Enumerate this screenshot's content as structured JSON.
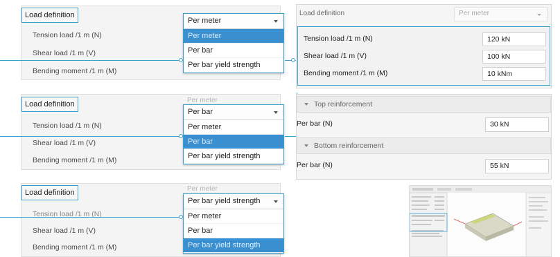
{
  "left_panels": [
    {
      "load_definition_label": "Load definition",
      "rows": [
        "Tension load /1 m (N)",
        "Shear load /1 m (V)",
        "Bending moment /1 m (M)"
      ],
      "ghost_value": "",
      "dropdown": {
        "selected": "Per meter",
        "options": [
          "Per meter",
          "Per bar",
          "Per bar yield strength"
        ],
        "highlighted_index": 0
      }
    },
    {
      "load_definition_label": "Load definition",
      "rows": [
        "Tension load /1 m (N)",
        "Shear load /1 m (V)",
        "Bending moment /1 m (M)"
      ],
      "ghost_value": "Per meter",
      "dropdown": {
        "selected": "Per bar",
        "options": [
          "Per meter",
          "Per bar",
          "Per bar yield strength"
        ],
        "highlighted_index": 1
      }
    },
    {
      "load_definition_label": "Load definition",
      "rows": [
        "Tension load /1 m (N)",
        "Shear load /1 m (V)",
        "Bending moment /1 m (M)"
      ],
      "ghost_value": "Per meter",
      "dropdown": {
        "selected": "Per bar yield strength",
        "options": [
          "Per meter",
          "Per bar",
          "Per bar yield strength"
        ],
        "highlighted_index": 2
      }
    }
  ],
  "right_top": {
    "title": "Load definition",
    "select_value": "Per meter",
    "fields": [
      {
        "label": "Tension load /1 m (N)",
        "value": "120 kN"
      },
      {
        "label": "Shear load /1 m (V)",
        "value": "100 kN"
      },
      {
        "label": "Bending moment /1 m (M)",
        "value": "10 kNm"
      }
    ]
  },
  "right_middle": {
    "top_section": "Top reinforcement",
    "top_field": {
      "label": "Per bar (N)",
      "value": "30 kN"
    },
    "bottom_section": "Bottom reinforcement",
    "bottom_field": {
      "label": "Per bar (N)",
      "value": "55 kN"
    }
  },
  "colors": {
    "accent": "#3aa0cf",
    "selection": "#3a8fd1",
    "panel_bg": "#f4f4f4"
  }
}
